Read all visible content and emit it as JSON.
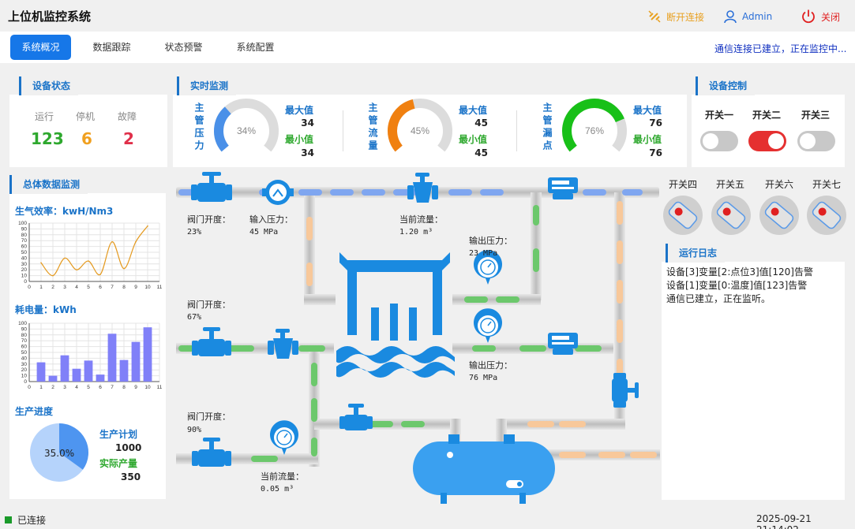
{
  "app": {
    "title": "上位机监控系统"
  },
  "header": {
    "disconnect": "断开连接",
    "user": "Admin",
    "close": "关闭"
  },
  "tabs": [
    {
      "label": "系统概况"
    },
    {
      "label": "数据跟踪"
    },
    {
      "label": "状态预警"
    },
    {
      "label": "系统配置"
    }
  ],
  "connection_message": "通信连接已建立，正在监控中...",
  "device_status": {
    "title": "设备状态",
    "items": [
      {
        "label": "运行",
        "value": "123",
        "color": "#2ea82e"
      },
      {
        "label": "停机",
        "value": "6",
        "color": "#f0a020"
      },
      {
        "label": "故障",
        "value": "2",
        "color": "#e0304a"
      }
    ]
  },
  "realtime": {
    "title": "实时监测",
    "gauges": [
      {
        "label": "主管压力",
        "percent": "34%",
        "value": 34,
        "color": "#4a90e8",
        "max_label": "最大值",
        "max": "34",
        "min_label": "最小值",
        "min": "34"
      },
      {
        "label": "主管流量",
        "percent": "45%",
        "value": 45,
        "color": "#f08010",
        "max_label": "最大值",
        "max": "45",
        "min_label": "最小值",
        "min": "45"
      },
      {
        "label": "主管漏点",
        "percent": "76%",
        "value": 76,
        "color": "#18c018",
        "max_label": "最大值",
        "max": "76",
        "min_label": "最小值",
        "min": "76"
      }
    ]
  },
  "device_control": {
    "title": "设备控制",
    "switches": [
      {
        "label": "开关一",
        "on": false
      },
      {
        "label": "开关二",
        "on": true
      },
      {
        "label": "开关三",
        "on": false
      }
    ],
    "rotary": [
      {
        "label": "开关四"
      },
      {
        "label": "开关五"
      },
      {
        "label": "开关六"
      },
      {
        "label": "开关七"
      }
    ]
  },
  "overall": {
    "title": "总体数据监测",
    "chart1_title": "生气效率：kwH/Nm3",
    "chart2_title": "耗电量：kWh",
    "progress_title": "生产进度",
    "plan_label": "生产计划",
    "plan": "1000",
    "actual_label": "实际产量",
    "actual": "350",
    "pie_label": "35.0%",
    "pie_value": 0.35
  },
  "chart_data": [
    {
      "type": "line",
      "title": "生气效率：kwH/Nm3",
      "x": [
        1,
        2,
        3,
        4,
        5,
        6,
        7,
        8,
        9,
        10
      ],
      "values": [
        32,
        10,
        40,
        20,
        35,
        12,
        68,
        22,
        68,
        95
      ],
      "xlim": [
        0,
        11
      ],
      "ylim": [
        0,
        100
      ],
      "xticks": [
        "0",
        "1",
        "2",
        "3",
        "4",
        "5",
        "6",
        "7",
        "8",
        "9",
        "10",
        "11"
      ],
      "yticks": [
        "0",
        "10",
        "20",
        "30",
        "40",
        "50",
        "60",
        "70",
        "80",
        "90",
        "100"
      ],
      "color": "#e49a20"
    },
    {
      "type": "bar",
      "title": "耗电量：kWh",
      "x": [
        1,
        2,
        3,
        4,
        5,
        6,
        7,
        8,
        9,
        10
      ],
      "values": [
        33,
        10,
        45,
        22,
        36,
        12,
        82,
        37,
        68,
        93
      ],
      "xlim": [
        0,
        11
      ],
      "ylim": [
        0,
        100
      ],
      "xticks": [
        "0",
        "1",
        "2",
        "3",
        "4",
        "5",
        "6",
        "7",
        "8",
        "9",
        "10",
        "11"
      ],
      "yticks": [
        "0",
        "10",
        "20",
        "30",
        "40",
        "50",
        "60",
        "70",
        "80",
        "90",
        "100"
      ],
      "color": "#8080f8"
    }
  ],
  "process": {
    "valve1_label": "阀门开度：",
    "valve1": "23%",
    "in_pressure_label": "输入压力：",
    "in_pressure": "45 MPa",
    "flow1_label": "当前流量：",
    "flow1": "1.20 m³",
    "out1_label": "输出压力：",
    "out1": "23 MPa",
    "valve2_label": "阀门开度：",
    "valve2": "67%",
    "out2_label": "输出压力：",
    "out2": "76 MPa",
    "valve3_label": "阀门开度：",
    "valve3": "90%",
    "flow2_label": "当前流量：",
    "flow2": "0.05 m³"
  },
  "log": {
    "title": "运行日志",
    "lines": [
      "设备[3]变量[2:点位3]值[120]告警",
      "设备[1]变量[0:温度]值[123]告警",
      "通信已建立，正在监听。"
    ]
  },
  "statusbar": {
    "connected": "已连接",
    "datetime": "2025-09-21 21:14:02"
  }
}
